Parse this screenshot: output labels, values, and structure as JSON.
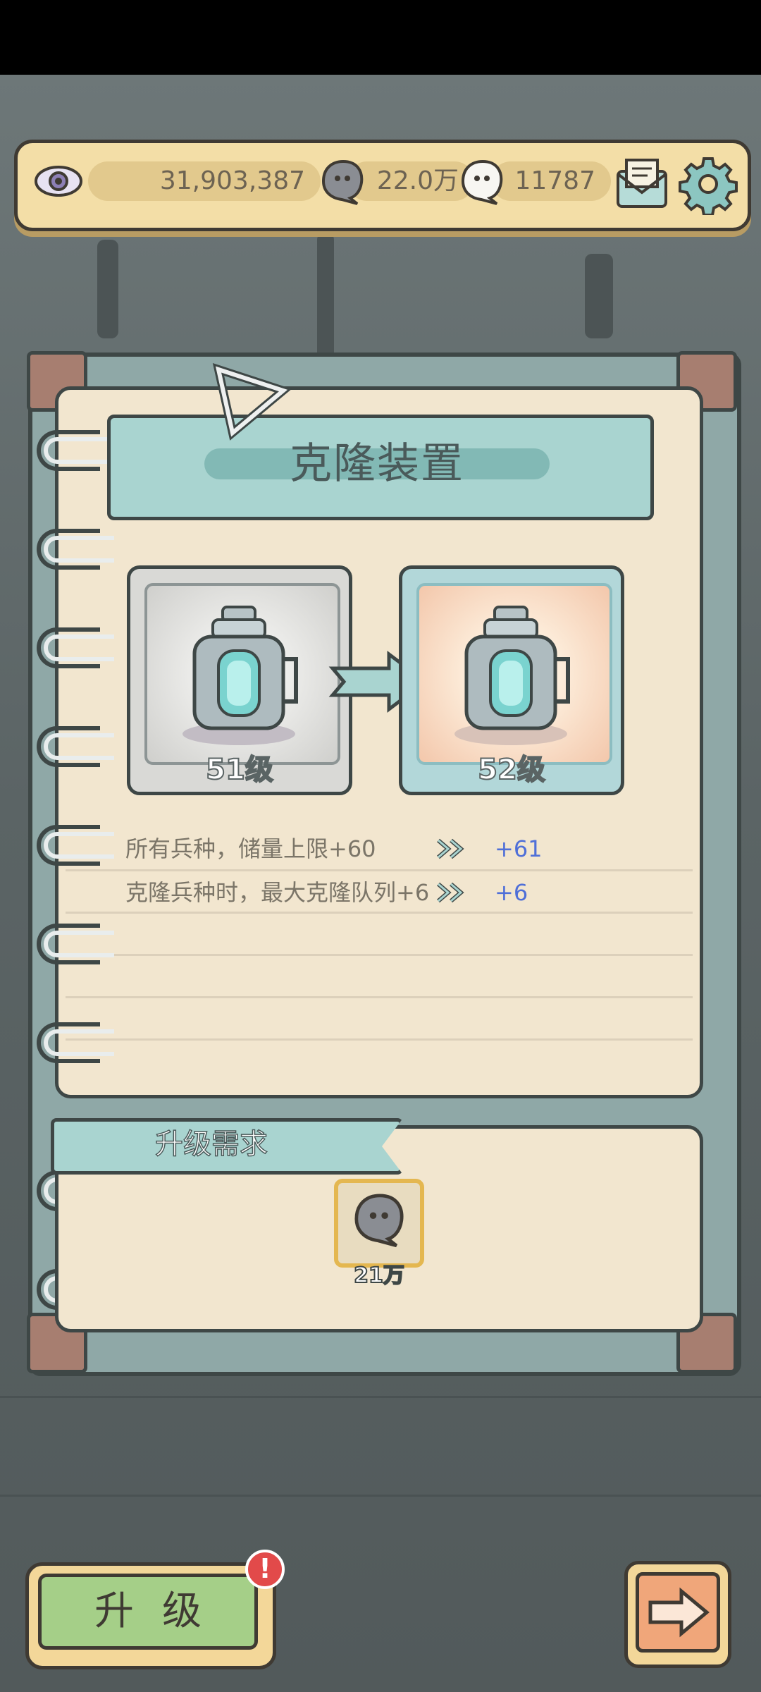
{
  "resources": {
    "eye_amount": "31,903,387",
    "gray_spirit_amount": "22.0万",
    "white_spirit_amount": "11787"
  },
  "icons": {
    "eye": "eye-icon",
    "gray_spirit": "gray-spirit-icon",
    "white_spirit": "white-spirit-icon",
    "mail": "mail-icon",
    "settings": "gear-icon",
    "arrow_right": "arrow-right-icon",
    "double_chevron": "double-chevron-icon",
    "clone_device": "clone-device-icon",
    "alert": "alert-icon"
  },
  "panel": {
    "title": "克隆装置",
    "current_level": "51级",
    "next_level": "52级",
    "stats": [
      {
        "label": "所有兵种，储量上限+60",
        "next": "+61"
      },
      {
        "label": "克隆兵种时，最大克隆队列+6",
        "next": "+6"
      }
    ]
  },
  "requirements": {
    "title": "升级需求",
    "item_amount": "21万"
  },
  "buttons": {
    "upgrade_label": "升级",
    "alert_mark": "!"
  },
  "colors": {
    "teal": "#a9d4d0",
    "paper": "#f2e6cf",
    "upgrade_green": "#a5cf88",
    "next_orange": "#f0a67a",
    "stat_blue": "#4f6fd8",
    "badge_red": "#e24a4a"
  }
}
